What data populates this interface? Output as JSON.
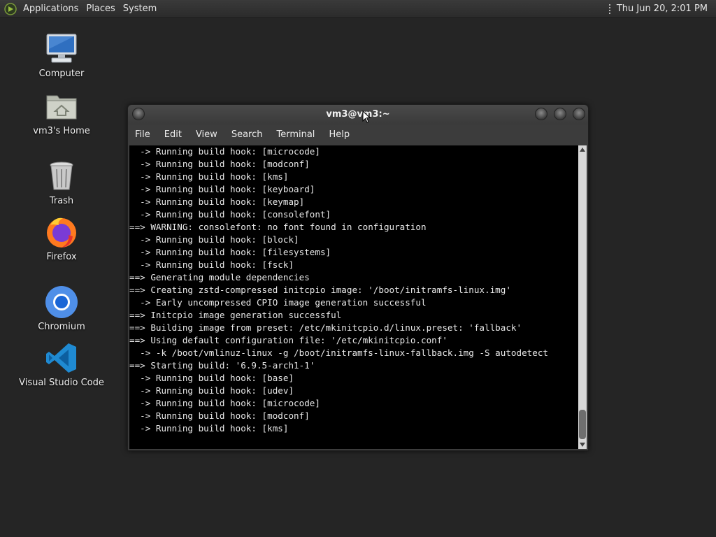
{
  "top_panel": {
    "menus": [
      "Applications",
      "Places",
      "System"
    ],
    "clock": "Thu Jun 20,  2:01 PM"
  },
  "desktop_icons": [
    {
      "label": "Computer",
      "icon": "computer-icon"
    },
    {
      "label": "vm3's Home",
      "icon": "home-folder-icon"
    },
    {
      "label": "Trash",
      "icon": "trash-icon"
    },
    {
      "label": "Firefox",
      "icon": "firefox-icon"
    },
    {
      "label": "Chromium",
      "icon": "chromium-icon"
    },
    {
      "label": "Visual Studio Code",
      "icon": "vscode-icon"
    }
  ],
  "terminal": {
    "title": "vm3@vm3:~",
    "menu": [
      "File",
      "Edit",
      "View",
      "Search",
      "Terminal",
      "Help"
    ],
    "lines": [
      "  -> Running build hook: [microcode]",
      "  -> Running build hook: [modconf]",
      "  -> Running build hook: [kms]",
      "  -> Running build hook: [keyboard]",
      "  -> Running build hook: [keymap]",
      "  -> Running build hook: [consolefont]",
      "==> WARNING: consolefont: no font found in configuration",
      "  -> Running build hook: [block]",
      "  -> Running build hook: [filesystems]",
      "  -> Running build hook: [fsck]",
      "==> Generating module dependencies",
      "==> Creating zstd-compressed initcpio image: '/boot/initramfs-linux.img'",
      "  -> Early uncompressed CPIO image generation successful",
      "==> Initcpio image generation successful",
      "==> Building image from preset: /etc/mkinitcpio.d/linux.preset: 'fallback'",
      "==> Using default configuration file: '/etc/mkinitcpio.conf'",
      "  -> -k /boot/vmlinuz-linux -g /boot/initramfs-linux-fallback.img -S autodetect",
      "==> Starting build: '6.9.5-arch1-1'",
      "  -> Running build hook: [base]",
      "  -> Running build hook: [udev]",
      "  -> Running build hook: [microcode]",
      "  -> Running build hook: [modconf]",
      "  -> Running build hook: [kms]"
    ]
  }
}
